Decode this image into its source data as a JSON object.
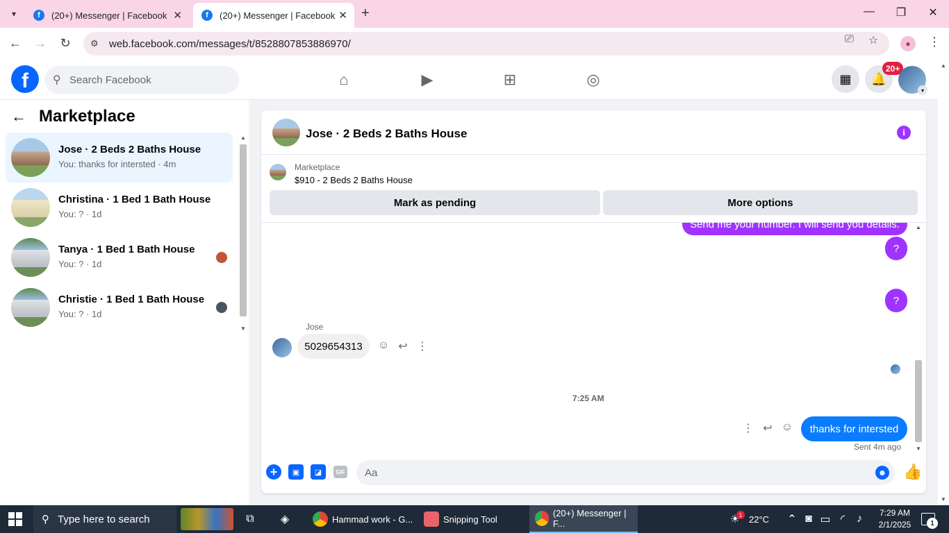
{
  "browser": {
    "tabs": [
      {
        "title": "(20+) Messenger | Facebook"
      },
      {
        "title": "(20+) Messenger | Facebook"
      }
    ],
    "url": "web.facebook.com/messages/t/8528807853886970/"
  },
  "fb_nav": {
    "logo_letter": "f",
    "search_placeholder": "Search Facebook",
    "notification_badge": "20+"
  },
  "left_panel": {
    "title": "Marketplace",
    "conversations": [
      {
        "title": "Jose · 2 Beds 2 Baths House",
        "subtitle": "You: thanks for intersted · 4m"
      },
      {
        "title": "Christina · 1 Bed 1 Bath House",
        "subtitle": "You: ? · 1d"
      },
      {
        "title": "Tanya · 1 Bed 1 Bath House",
        "subtitle": "You: ? · 1d"
      },
      {
        "title": "Christie · 1 Bed 1 Bath House",
        "subtitle": "You: ? · 1d"
      }
    ]
  },
  "chat": {
    "title": "Jose · 2 Beds 2 Baths House",
    "listing": {
      "label": "Marketplace",
      "price_title": "$910 - 2 Beds 2 Baths House",
      "pending_button": "Mark as pending",
      "more_button": "More options"
    },
    "messages": {
      "partial_outgoing": "Send me your number. I will send you details.",
      "q1": "?",
      "q2": "?",
      "sender_name": "Jose",
      "incoming": "5029654313",
      "time_divider": "7:25 AM",
      "outgoing_last": "thanks for intersted",
      "sent_status": "Sent 4m ago"
    },
    "composer": {
      "placeholder": "Aa",
      "gif_label": "GIF"
    }
  },
  "taskbar": {
    "search_text": "Type here to search",
    "apps": [
      {
        "label": "Hammad work - G..."
      },
      {
        "label": "Snipping Tool"
      },
      {
        "label": "(20+) Messenger | F..."
      }
    ],
    "weather_badge": "1",
    "temperature": "22°C",
    "time": "7:29 AM",
    "date": "2/1/2025",
    "notification_count": "1"
  }
}
